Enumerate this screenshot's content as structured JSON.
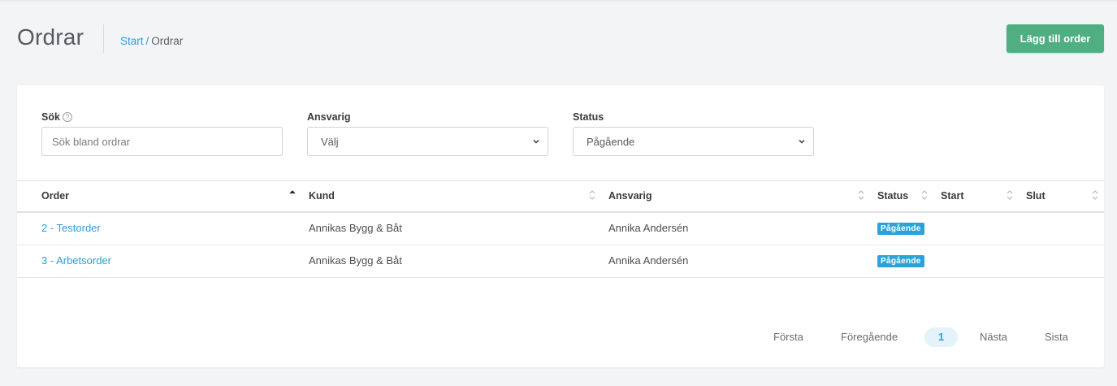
{
  "header": {
    "title": "Ordrar",
    "breadcrumb": {
      "home": "Start",
      "separator": "/",
      "current": "Ordrar"
    },
    "add_button": "Lägg till order"
  },
  "filters": {
    "search": {
      "label": "Sök",
      "help": "?",
      "placeholder": "Sök bland ordrar",
      "value": ""
    },
    "responsible": {
      "label": "Ansvarig",
      "value": "Välj"
    },
    "status": {
      "label": "Status",
      "value": "Pågående"
    }
  },
  "table": {
    "columns": [
      "Order",
      "Kund",
      "Ansvarig",
      "Status",
      "Start",
      "Slut"
    ],
    "rows": [
      {
        "order": "2 - Testorder",
        "kund": "Annikas Bygg & Båt",
        "ansvarig": "Annika Andersén",
        "status": "Pågående",
        "start": "",
        "slut": ""
      },
      {
        "order": "3 - Arbetsorder",
        "kund": "Annikas Bygg & Båt",
        "ansvarig": "Annika Andersén",
        "status": "Pågående",
        "start": "",
        "slut": ""
      }
    ]
  },
  "pagination": {
    "first": "Första",
    "previous": "Föregående",
    "current": "1",
    "next": "Nästa",
    "last": "Sista"
  },
  "colors": {
    "accent": "#2d9fd8",
    "button": "#4fae82",
    "badge": "#2aa3d8",
    "background": "#f3f4f6"
  }
}
